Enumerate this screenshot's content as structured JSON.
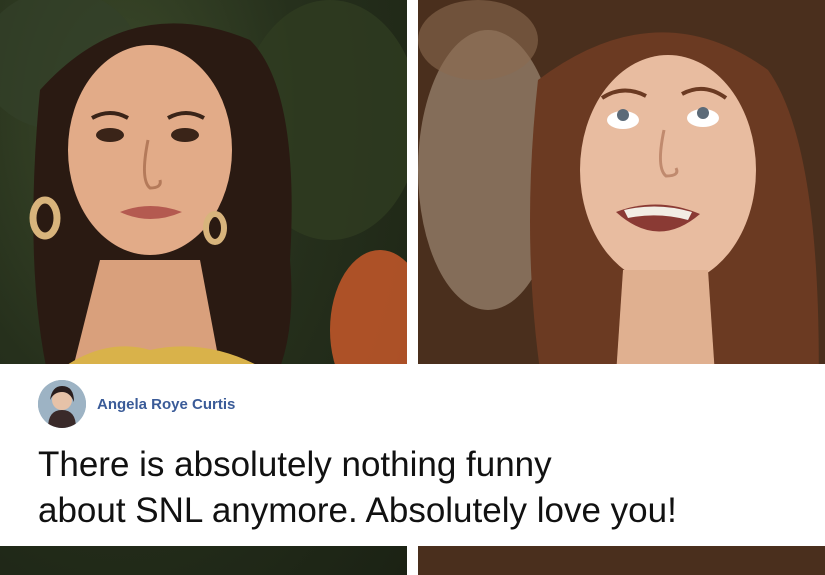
{
  "comment": {
    "author": "Angela Roye Curtis",
    "text": "There is absolutely nothing funny\nabout SNL anymore. Absolutely love you!",
    "author_color": "#3a5b98"
  },
  "images": [
    {
      "subject": "woman-with-hoop-earrings",
      "background": "garden"
    },
    {
      "subject": "woman-crying",
      "background": "indoor"
    }
  ]
}
